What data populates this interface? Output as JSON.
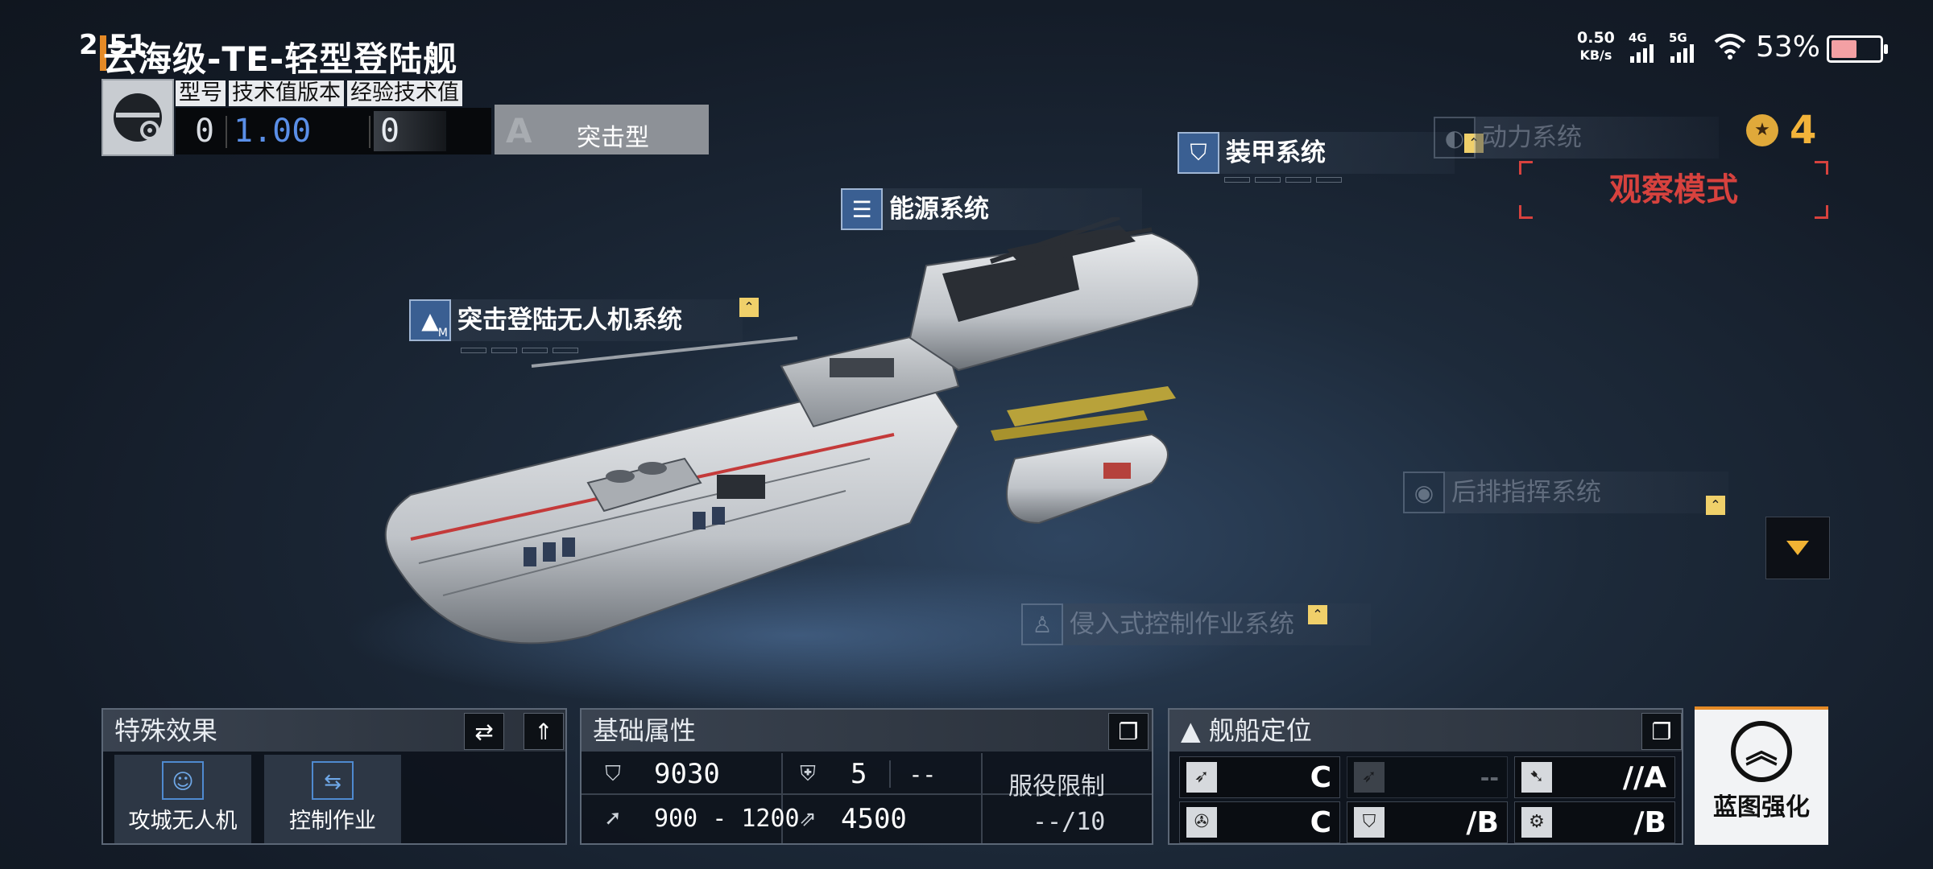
{
  "status_bar": {
    "time": "2:51",
    "net_speed_value": "0.50",
    "net_speed_unit": "KB/s",
    "net_type_1": "4G",
    "net_type_2": "5G",
    "battery": "53%",
    "battery_level": 0.53
  },
  "ship": {
    "title": "云海级-TE-轻型登陆舰",
    "stats_headers": [
      "型号",
      "技术值版本",
      "经验技术值"
    ],
    "model": "0",
    "tech_version": "1.00",
    "exp_tech": "0",
    "role_letter": "A",
    "role": "突击型"
  },
  "systems": {
    "armor": "装甲系统",
    "power": "动力系统",
    "energy": "能源系统",
    "drone": "突击登陆无人机系统",
    "rear_command": "后排指挥系统",
    "intrusive_control": "侵入式控制作业系统",
    "drone_badge": "M"
  },
  "mode": {
    "observe": "观察模式",
    "points": "4"
  },
  "special_effects": {
    "title": "特殊效果",
    "items": [
      "攻城无人机",
      "控制作业"
    ]
  },
  "base_attrs": {
    "title": "基础属性",
    "hp": "9030",
    "armor_val": "5",
    "armor_extra": "--",
    "attack": "900 - 1200",
    "speed": "4500",
    "service_limit_label": "服役限制",
    "service_limit_value": "--/10"
  },
  "positioning": {
    "title": "舰船定位",
    "grades": [
      "C",
      "--",
      "//A",
      "C",
      "/B",
      "/B"
    ]
  },
  "blueprint": {
    "label": "蓝图强化"
  },
  "colors": {
    "accent_orange": "#e58a26",
    "observe_red": "#d7423e",
    "points_gold": "#f2b33a",
    "system_blue": "#3a5f92"
  }
}
